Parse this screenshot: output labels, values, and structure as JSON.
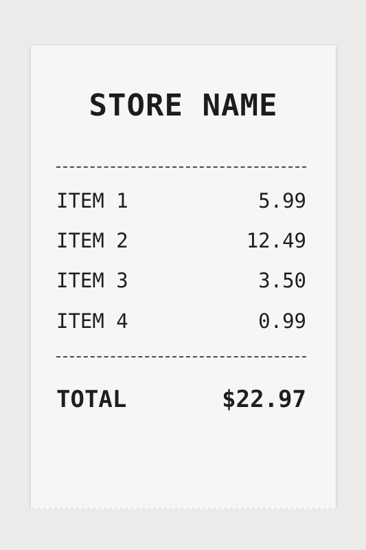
{
  "receipt": {
    "store_name": "STORE NAME",
    "items": [
      {
        "label": "ITEM 1",
        "price": "5.99"
      },
      {
        "label": "ITEM 2",
        "price": "12.49"
      },
      {
        "label": "ITEM 3",
        "price": "3.50"
      },
      {
        "label": "ITEM 4",
        "price": "0.99"
      }
    ],
    "total": {
      "label": "TOTAL",
      "amount": "$22.97"
    }
  },
  "colors": {
    "background": "#ebebea",
    "paper": "#f6f6f5",
    "ink": "#1c1c1c"
  }
}
